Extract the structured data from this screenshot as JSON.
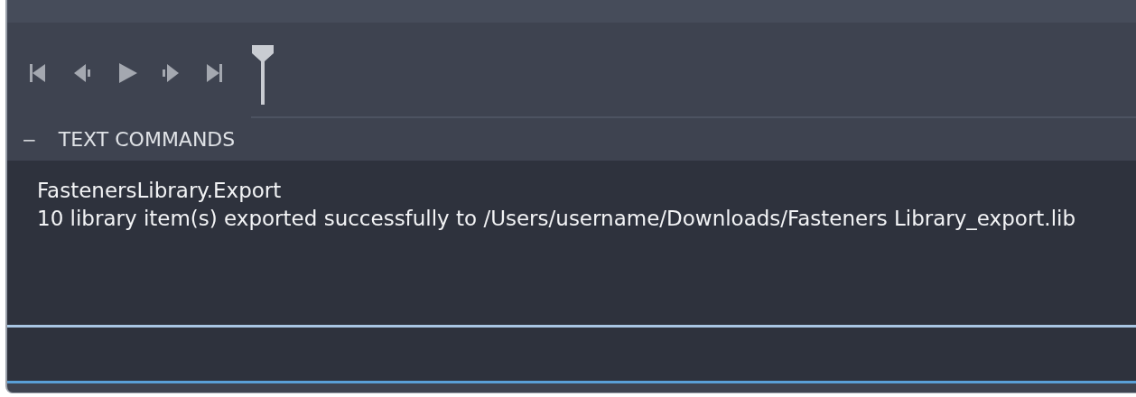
{
  "playback_controls": [
    {
      "kind": "first"
    },
    {
      "kind": "prev"
    },
    {
      "kind": "play"
    },
    {
      "kind": "next"
    },
    {
      "kind": "last"
    }
  ],
  "section": {
    "toggle": "−",
    "title": "TEXT COMMANDS"
  },
  "output_lines": [
    "FastenersLibrary.Export",
    "10 library item(s) exported successfully to /Users/username/Downloads/Fasteners Library_export.lib"
  ]
}
